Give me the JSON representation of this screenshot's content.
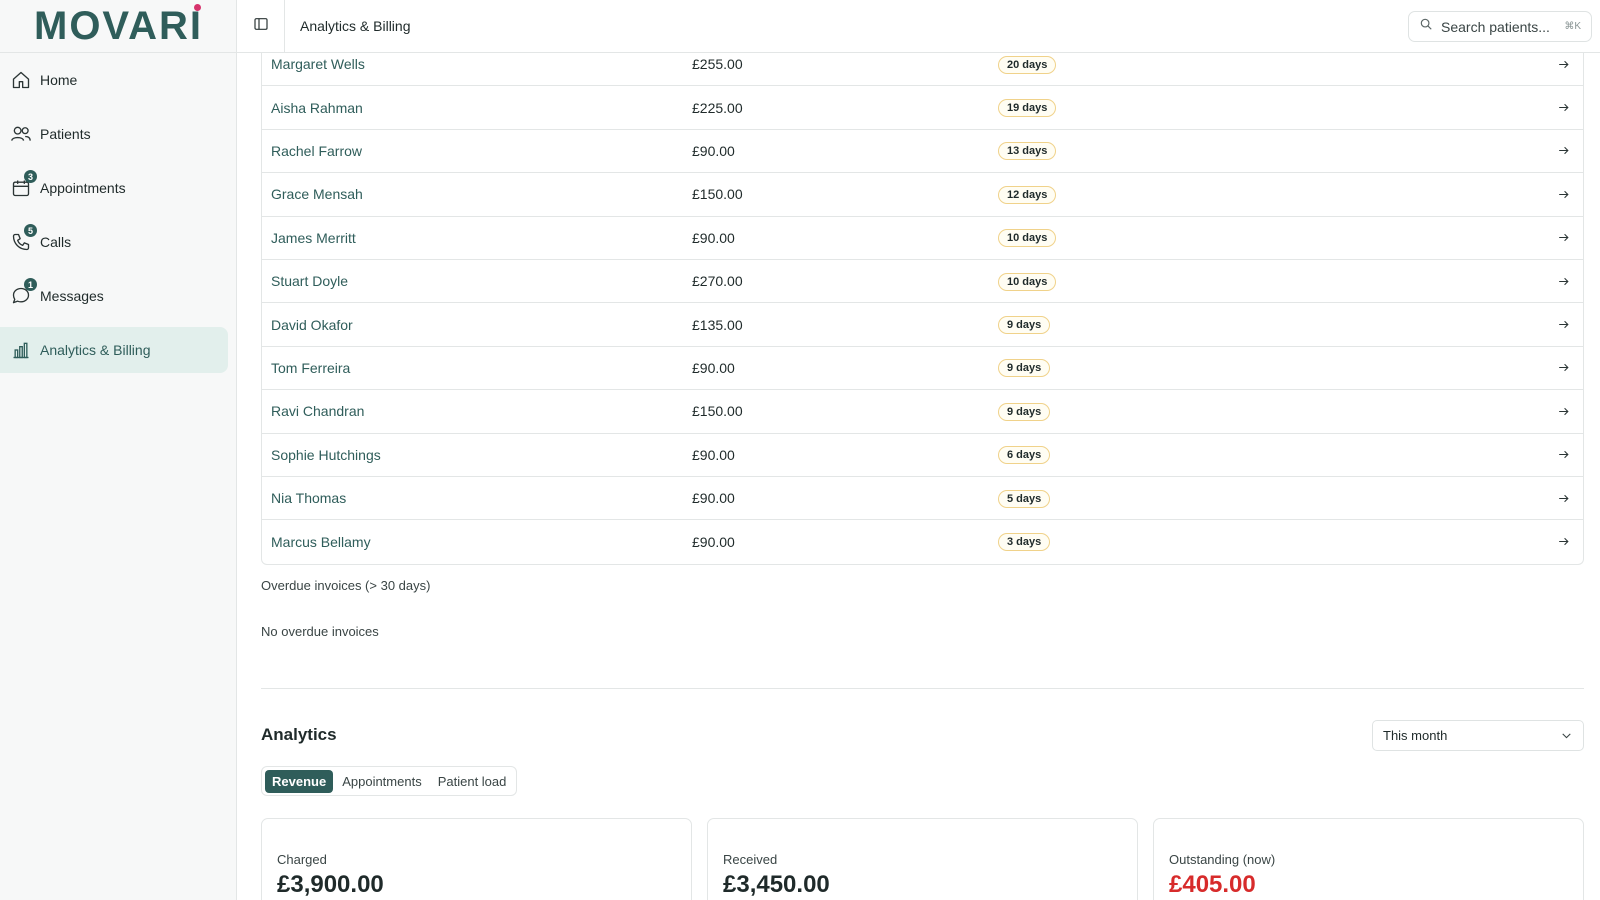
{
  "brand": {
    "name": "MOVARI",
    "accent": "#2f5d5a",
    "dot_color": "#d6336c"
  },
  "sidebar": {
    "items": [
      {
        "label": "Home",
        "icon": "home-icon",
        "badge": null,
        "active": false
      },
      {
        "label": "Patients",
        "icon": "users-icon",
        "badge": null,
        "active": false
      },
      {
        "label": "Appointments",
        "icon": "calendar-icon",
        "badge": "3",
        "active": false
      },
      {
        "label": "Calls",
        "icon": "phone-icon",
        "badge": "5",
        "active": false
      },
      {
        "label": "Messages",
        "icon": "message-icon",
        "badge": "1",
        "active": false
      },
      {
        "label": "Analytics & Billing",
        "icon": "bar-chart-icon",
        "badge": null,
        "active": true
      }
    ]
  },
  "header": {
    "title": "Analytics & Billing",
    "search_placeholder": "Search patients...",
    "search_shortcut": "⌘K"
  },
  "outstanding_table": {
    "rows": [
      {
        "name": "Margaret Wells",
        "amount": "£255.00",
        "days": "20 days"
      },
      {
        "name": "Aisha Rahman",
        "amount": "£225.00",
        "days": "19 days"
      },
      {
        "name": "Rachel Farrow",
        "amount": "£90.00",
        "days": "13 days"
      },
      {
        "name": "Grace Mensah",
        "amount": "£150.00",
        "days": "12 days"
      },
      {
        "name": "James Merritt",
        "amount": "£90.00",
        "days": "10 days"
      },
      {
        "name": "Stuart Doyle",
        "amount": "£270.00",
        "days": "10 days"
      },
      {
        "name": "David Okafor",
        "amount": "£135.00",
        "days": "9 days"
      },
      {
        "name": "Tom Ferreira",
        "amount": "£90.00",
        "days": "9 days"
      },
      {
        "name": "Ravi Chandran",
        "amount": "£150.00",
        "days": "9 days"
      },
      {
        "name": "Sophie Hutchings",
        "amount": "£90.00",
        "days": "6 days"
      },
      {
        "name": "Nia Thomas",
        "amount": "£90.00",
        "days": "5 days"
      },
      {
        "name": "Marcus Bellamy",
        "amount": "£90.00",
        "days": "3 days"
      }
    ]
  },
  "overdue": {
    "title": "Overdue invoices (> 30 days)",
    "empty_text": "No overdue invoices"
  },
  "analytics": {
    "title": "Analytics",
    "period": "This month",
    "tabs": [
      {
        "label": "Revenue",
        "active": true
      },
      {
        "label": "Appointments",
        "active": false
      },
      {
        "label": "Patient load",
        "active": false
      }
    ],
    "cards": [
      {
        "label": "Charged",
        "value": "£3,900.00",
        "alert": false
      },
      {
        "label": "Received",
        "value": "£3,450.00",
        "alert": false
      },
      {
        "label": "Outstanding (now)",
        "value": "£405.00",
        "alert": true
      }
    ]
  },
  "colors": {
    "alert": "#d72b2b",
    "pill_border": "#f0d28a"
  }
}
